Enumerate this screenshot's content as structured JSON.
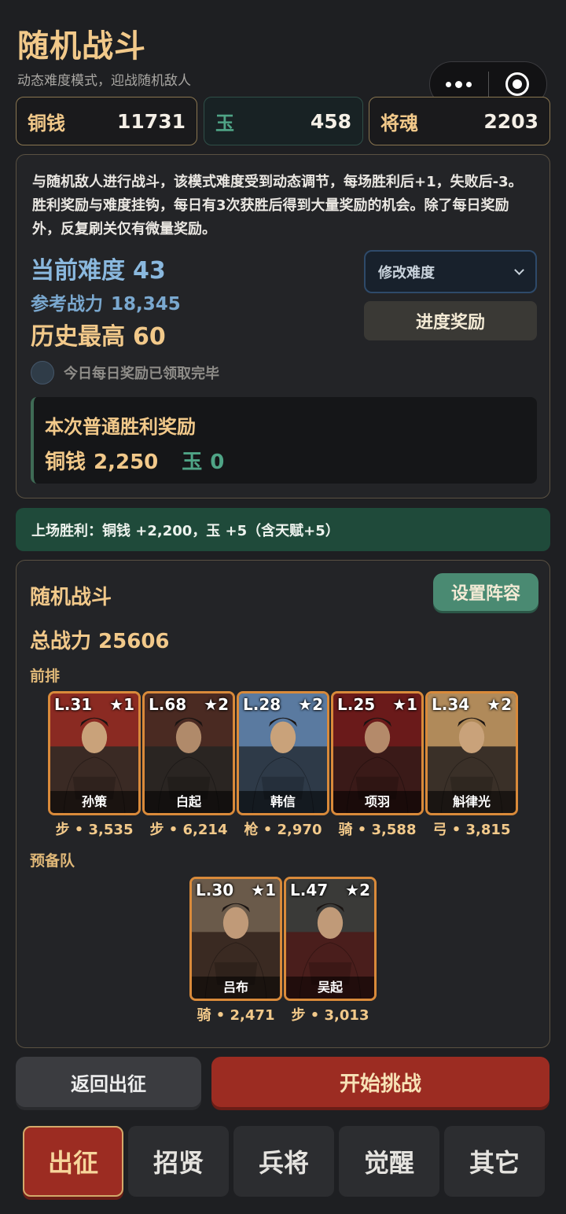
{
  "header": {
    "title": "随机战斗",
    "subtitle": "动态难度模式，迎战随机敌人"
  },
  "currency": {
    "copper_label": "铜钱",
    "copper_value": "11731",
    "jade_label": "玉",
    "jade_value": "458",
    "soul_label": "将魂",
    "soul_value": "2203"
  },
  "info": {
    "description": "与随机敌人进行战斗，该模式难度受到动态调节，每场胜利后+1，失败后-3。胜利奖励与难度挂钩，每日有3次获胜后得到大量奖励的机会。除了每日奖励外，反复刷关仅有微量奖励。",
    "difficulty_label": "当前难度",
    "difficulty_value": "43",
    "power_label": "参考战力",
    "power_value": "18,345",
    "best_label": "历史最高",
    "best_value": "60",
    "select_label": "修改难度",
    "progress_button": "进度奖励",
    "daily_status": "今日每日奖励已领取完毕",
    "reward_title": "本次普通胜利奖励",
    "reward_copper_label": "铜钱",
    "reward_copper_value": "2,250",
    "reward_jade_label": "玉",
    "reward_jade_value": "0"
  },
  "banner": "上场胜利：铜钱 +2,200，玉 +5（含天赋+5）",
  "battle": {
    "title": "随机战斗",
    "team_button": "设置阵容",
    "total_power": "总战力 25606",
    "front_label": "前排",
    "reserve_label": "预备队",
    "front": [
      {
        "level": "L.31",
        "stars": "★1",
        "name": "孙策",
        "stat": "步 • 3,535",
        "palette": [
          "#8a2a22",
          "#3a2a24",
          "#c9a27a"
        ]
      },
      {
        "level": "L.68",
        "stars": "★2",
        "name": "白起",
        "stat": "步 • 6,214",
        "palette": [
          "#4a2a22",
          "#2a2522",
          "#b08a6a"
        ]
      },
      {
        "level": "L.28",
        "stars": "★2",
        "name": "韩信",
        "stat": "枪 • 2,970",
        "palette": [
          "#5a7aa0",
          "#2e3a48",
          "#c9a27a"
        ]
      },
      {
        "level": "L.25",
        "stars": "★1",
        "name": "项羽",
        "stat": "骑 • 3,588",
        "palette": [
          "#6a1a1a",
          "#3a1a18",
          "#b48a6a"
        ]
      },
      {
        "level": "L.34",
        "stars": "★2",
        "name": "斛律光",
        "stat": "弓 • 3,815",
        "palette": [
          "#b08a5a",
          "#3a3028",
          "#c9a27a"
        ]
      }
    ],
    "reserve": [
      {
        "level": "L.30",
        "stars": "★1",
        "name": "吕布",
        "stat": "骑 • 2,471",
        "palette": [
          "#6a5a4a",
          "#3a2a22",
          "#c09a78"
        ]
      },
      {
        "level": "L.47",
        "stars": "★2",
        "name": "吴起",
        "stat": "步 • 3,013",
        "palette": [
          "#3a3a38",
          "#4a1e1c",
          "#c09a78"
        ]
      }
    ]
  },
  "actions": {
    "back_label": "返回出征",
    "start_label": "开始挑战"
  },
  "tabs": [
    {
      "label": "出征",
      "active": true
    },
    {
      "label": "招贤",
      "active": false
    },
    {
      "label": "兵将",
      "active": false
    },
    {
      "label": "觉醒",
      "active": false
    },
    {
      "label": "其它",
      "active": false
    }
  ]
}
